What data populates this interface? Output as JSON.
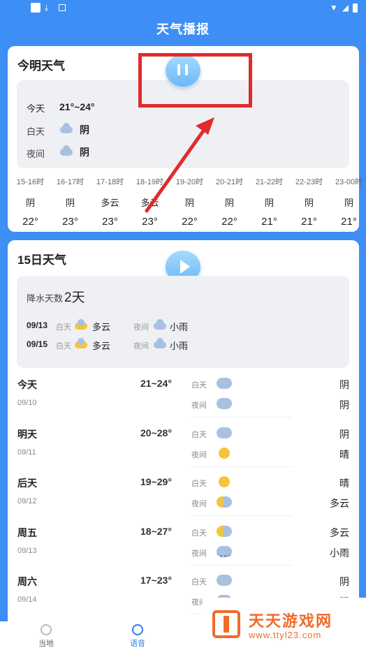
{
  "header": {
    "title": "天气播报"
  },
  "today_card": {
    "title": "今明天气",
    "summary": {
      "today_label": "今天",
      "today_range": "21°~24°",
      "day_label": "白天",
      "day_cond": "阴",
      "night_label": "夜间",
      "night_cond": "阴"
    },
    "hourly": [
      {
        "time": "15-16时",
        "cond": "阴",
        "temp": "22°"
      },
      {
        "time": "16-17时",
        "cond": "阴",
        "temp": "23°"
      },
      {
        "time": "17-18时",
        "cond": "多云",
        "temp": "23°"
      },
      {
        "time": "18-19时",
        "cond": "多云",
        "temp": "23°"
      },
      {
        "time": "19-20时",
        "cond": "阴",
        "temp": "22°"
      },
      {
        "time": "20-21时",
        "cond": "阴",
        "temp": "22°"
      },
      {
        "time": "21-22时",
        "cond": "阴",
        "temp": "21°"
      },
      {
        "time": "22-23时",
        "cond": "阴",
        "temp": "21°"
      },
      {
        "time": "23-00时",
        "cond": "阴",
        "temp": "21°"
      }
    ]
  },
  "forecast_card": {
    "title": "15日天气",
    "rain_label": "降水天数",
    "rain_days": "2天",
    "rain_rows": [
      {
        "date": "09/13",
        "day_label": "白天",
        "day_cond": "多云",
        "night_label": "夜间",
        "night_cond": "小雨"
      },
      {
        "date": "09/15",
        "day_label": "白天",
        "day_cond": "多云",
        "night_label": "夜间",
        "night_cond": "小雨"
      }
    ],
    "days": [
      {
        "name": "今天",
        "date": "09/10",
        "range": "21~24°",
        "day_label": "白天",
        "day_cond": "阴",
        "night_label": "夜间",
        "night_cond": "阴"
      },
      {
        "name": "明天",
        "date": "09/11",
        "range": "20~28°",
        "day_label": "白天",
        "day_cond": "阴",
        "night_label": "夜间",
        "night_cond": "晴"
      },
      {
        "name": "后天",
        "date": "09/12",
        "range": "19~29°",
        "day_label": "白天",
        "day_cond": "晴",
        "night_label": "夜间",
        "night_cond": "多云"
      },
      {
        "name": "周五",
        "date": "09/13",
        "range": "18~27°",
        "day_label": "白天",
        "day_cond": "多云",
        "night_label": "夜间",
        "night_cond": "小雨"
      },
      {
        "name": "周六",
        "date": "09/14",
        "range": "17~23°",
        "day_label": "白天",
        "day_cond": "阴",
        "night_label": "夜间",
        "night_cond": "阴"
      }
    ]
  },
  "nav": {
    "local": "当地",
    "voice": "语音"
  },
  "watermark": {
    "title": "天天游戏网",
    "url": "www.ttyl23.com"
  },
  "colors": {
    "background": "#3d8ef5",
    "accent": "#2f7de9",
    "annotation": "#e12b2b",
    "watermark": "#f06a2a"
  }
}
